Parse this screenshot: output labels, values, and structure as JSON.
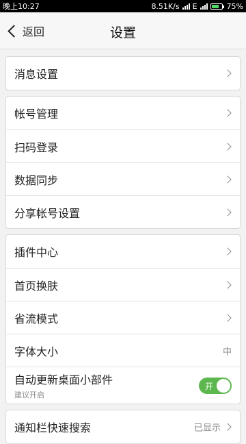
{
  "status_bar": {
    "time": "晚上10:27",
    "speed": "8.51K/s",
    "network": "E",
    "battery": "75%",
    "battery_level": 0.75
  },
  "header": {
    "back_label": "返回",
    "title": "设置"
  },
  "groups": [
    {
      "items": [
        {
          "label": "消息设置"
        }
      ]
    },
    {
      "items": [
        {
          "label": "帐号管理"
        },
        {
          "label": "扫码登录"
        },
        {
          "label": "数据同步"
        },
        {
          "label": "分享帐号设置"
        }
      ]
    },
    {
      "items": [
        {
          "label": "插件中心"
        },
        {
          "label": "首页换肤"
        },
        {
          "label": "省流模式"
        },
        {
          "label": "字体大小",
          "value": "中"
        },
        {
          "label": "自动更新桌面小部件",
          "sublabel": "建议开启",
          "toggle_label": "开",
          "toggle_on": true
        }
      ]
    },
    {
      "items": [
        {
          "label": "通知栏快速搜索",
          "value": "已显示"
        }
      ]
    }
  ],
  "colors": {
    "toggle_on": "#5cb84e",
    "battery": "#4cd964"
  }
}
